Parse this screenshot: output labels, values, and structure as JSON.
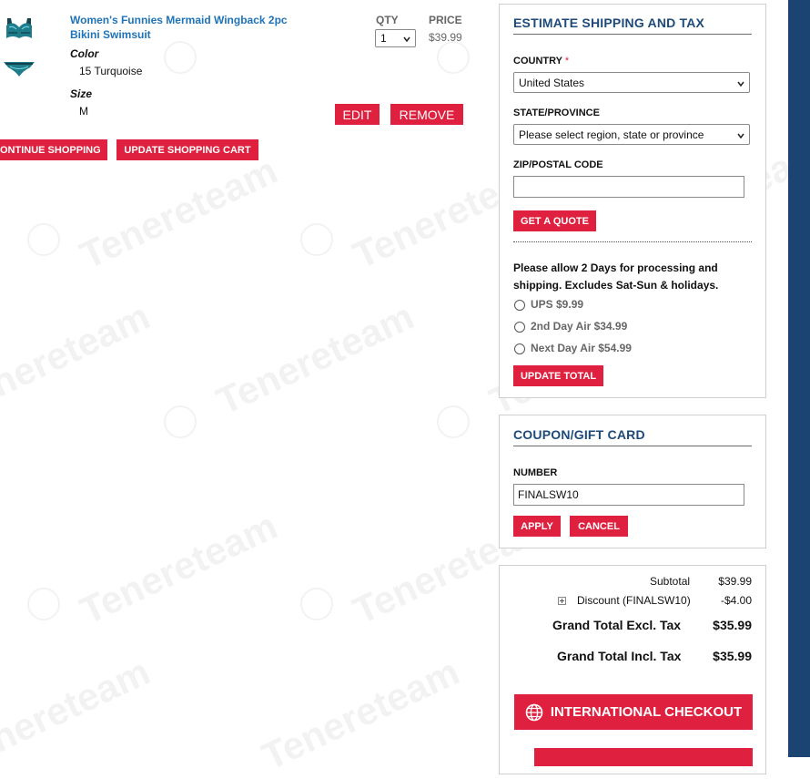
{
  "cart": {
    "item": {
      "name_line1": "Women's Funnies Mermaid Wingback 2pc",
      "name_line2": "Bikini Swimsuit",
      "color_label": "Color",
      "color_value": "15 Turquoise",
      "size_label": "Size",
      "size_value": "M",
      "qty_header": "QTY",
      "qty_value": "1",
      "price_header": "PRICE",
      "price_value": "$39.99",
      "edit_label": "EDIT",
      "remove_label": "REMOVE"
    },
    "continue_label": "ONTINUE SHOPPING",
    "update_cart_label": "UPDATE SHOPPING CART"
  },
  "shipping": {
    "title": "ESTIMATE SHIPPING AND TAX",
    "country_label": "COUNTRY",
    "required_mark": "*",
    "country_value": "United States",
    "state_label": "STATE/PROVINCE",
    "state_placeholder": "Please select region, state or province",
    "zip_label": "ZIP/POSTAL CODE",
    "zip_value": "",
    "quote_label": "GET A QUOTE",
    "note_line1": "Please allow 2 Days for processing and",
    "note_line2": "shipping. Excludes Sat-Sun & holidays.",
    "options": [
      {
        "label": "UPS $9.99"
      },
      {
        "label": "2nd Day Air $34.99"
      },
      {
        "label": "Next Day Air $54.99"
      }
    ],
    "update_total_label": "UPDATE TOTAL"
  },
  "coupon": {
    "title": "COUPON/GIFT CARD",
    "number_label": "NUMBER",
    "number_value": "FINALSW10",
    "apply_label": "APPLY",
    "cancel_label": "CANCEL"
  },
  "totals": {
    "subtotal_label": "Subtotal",
    "subtotal_value": "$39.99",
    "discount_label": "Discount (FINALSW10)",
    "discount_value": "-$4.00",
    "grand_excl_label": "Grand Total Excl. Tax",
    "grand_excl_value": "$35.99",
    "grand_incl_label": "Grand Total Incl. Tax",
    "grand_incl_value": "$35.99",
    "intl_checkout_label": "INTERNATIONAL CHECKOUT"
  },
  "watermark": {
    "text": "Tenereteam",
    "logo_caption": "tenere"
  },
  "colors": {
    "accent_red": "#e0203f",
    "link_blue": "#1f73b7",
    "heading_navy": "#1e4a7a",
    "scroll_strip": "#1c4473"
  },
  "icons": {
    "globe": "globe-icon",
    "expand": "plus-box-icon",
    "chevron": "chevron-down-icon"
  }
}
